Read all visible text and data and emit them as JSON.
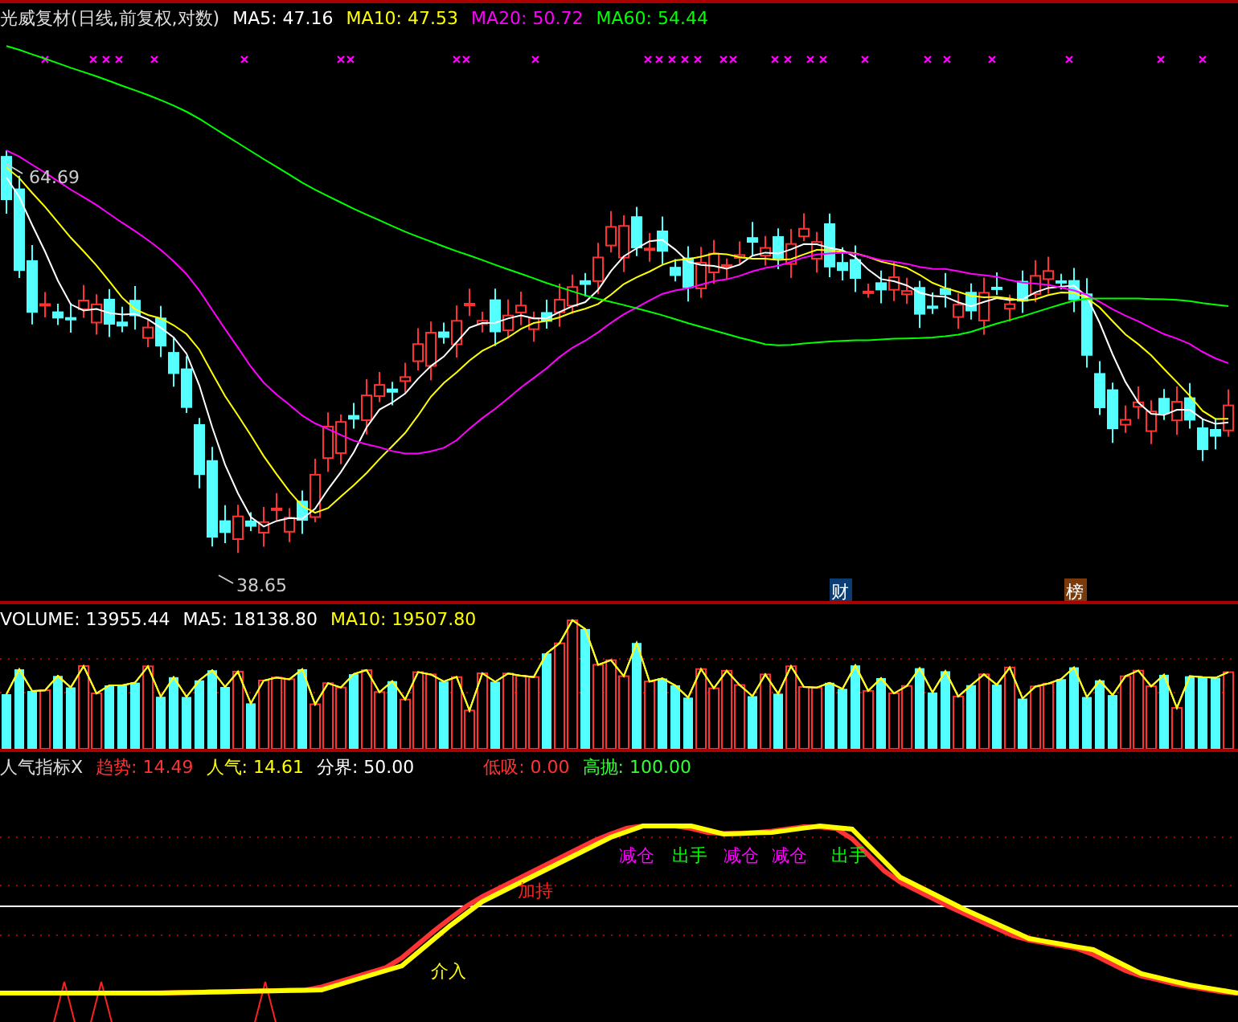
{
  "main_chart": {
    "title": "光威复材(日线,前复权,对数)",
    "indicators": [
      {
        "label": "MA5: 47.16",
        "color": "#ffffff"
      },
      {
        "label": "MA10: 47.53",
        "color": "#ffff00"
      },
      {
        "label": "MA20: 50.72",
        "color": "#ff00ff"
      },
      {
        "label": "MA60: 54.44",
        "color": "#00ff00"
      }
    ],
    "high_label": "64.69",
    "low_label": "38.65",
    "event_badges": [
      {
        "label": "财",
        "color": "#0a3d73"
      },
      {
        "label": "榜",
        "color": "#7a3a0a"
      }
    ]
  },
  "volume_panel": {
    "indicators": [
      {
        "label": "VOLUME: 13955.44",
        "color": "#ffffff"
      },
      {
        "label": "MA5: 18138.80",
        "color": "#ffffff"
      },
      {
        "label": "MA10: 19507.80",
        "color": "#ffff00"
      }
    ]
  },
  "indicator_panel": {
    "title": "人气指标X",
    "indicators": [
      {
        "label": "趋势: 14.49",
        "color": "#ff3333"
      },
      {
        "label": "人气: 14.61",
        "color": "#ffff00"
      },
      {
        "label": "分界: 50.00",
        "color": "#ffffff"
      }
    ],
    "thresholds": [
      {
        "label": "低吸: 0.00",
        "color": "#ff3333"
      },
      {
        "label": "高抛: 100.00",
        "color": "#33ff33"
      }
    ],
    "signals": [
      {
        "label": "介入",
        "color": "#ffff00"
      },
      {
        "label": "加持",
        "color": "#ff2020"
      },
      {
        "label": "减仓",
        "color": "#ff00ff"
      },
      {
        "label": "出手",
        "color": "#00ff00"
      },
      {
        "label": "减仓",
        "color": "#ff00ff"
      },
      {
        "label": "减仓",
        "color": "#ff00ff"
      },
      {
        "label": "出手",
        "color": "#00ff00"
      }
    ]
  }
}
